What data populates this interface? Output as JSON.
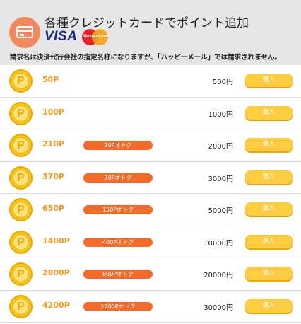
{
  "header": {
    "title": "各種クレジットカードでポイント追加",
    "icon": "credit-card-icon",
    "visa_text": "VISA",
    "mastercard_text": "MasterCard",
    "note": "請求名は決済代行会社の指定名称になりますが、「ハッピーメール」では請求されません。"
  },
  "colors": {
    "accent_orange": "#f39a1e",
    "bonus_badge": "#f26b2b",
    "buy_button": "#fecc41",
    "header_bg": "#e6e6e6"
  },
  "coin_letter": "P",
  "packages": [
    {
      "points": "50P",
      "bonus": "",
      "price": "500円",
      "buy_label": "購入"
    },
    {
      "points": "100P",
      "bonus": "",
      "price": "1000円",
      "buy_label": "購入"
    },
    {
      "points": "210P",
      "bonus": "10Pオトク",
      "price": "2000円",
      "buy_label": "購入"
    },
    {
      "points": "370P",
      "bonus": "70Pオトク",
      "price": "3000円",
      "buy_label": "購入"
    },
    {
      "points": "650P",
      "bonus": "150Pオトク",
      "price": "5000円",
      "buy_label": "購入"
    },
    {
      "points": "1400P",
      "bonus": "400Pオトク",
      "price": "10000円",
      "buy_label": "購入"
    },
    {
      "points": "2800P",
      "bonus": "800Pオトク",
      "price": "20000円",
      "buy_label": "購入"
    },
    {
      "points": "4200P",
      "bonus": "1200Pオトク",
      "price": "30000円",
      "buy_label": "購入"
    }
  ]
}
